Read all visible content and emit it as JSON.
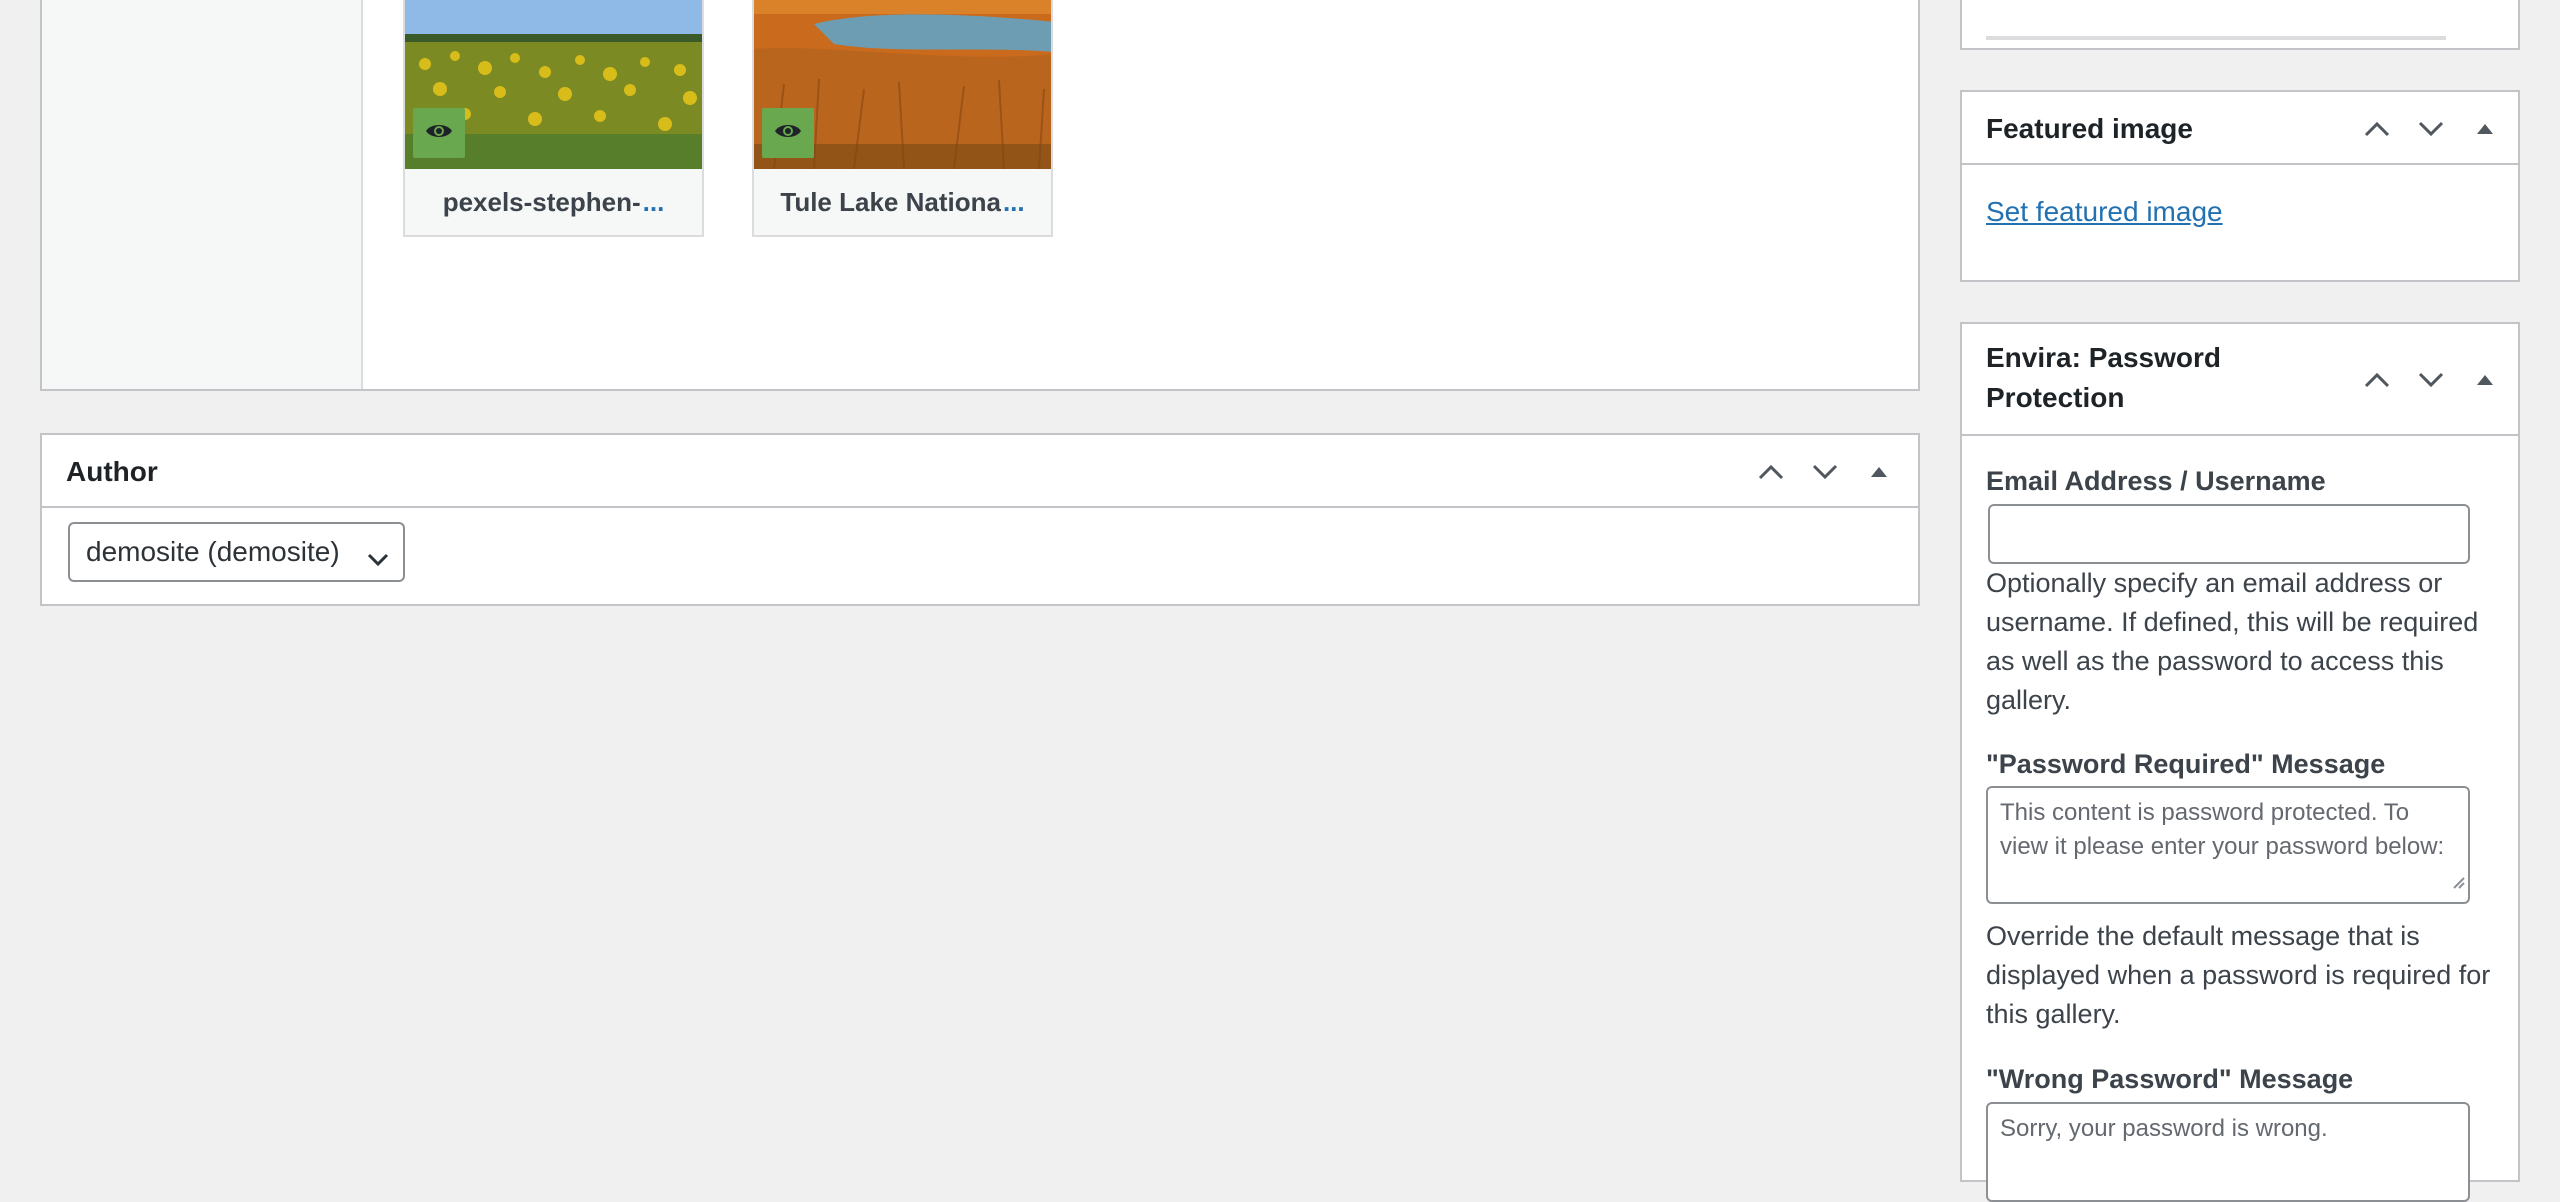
{
  "gallery": {
    "images": [
      {
        "title": "pexels-stephen-",
        "ellipsis": "...",
        "preview_icon": "eye-icon"
      },
      {
        "title": "Tule Lake Nationa",
        "ellipsis": "...",
        "preview_icon": "eye-icon"
      }
    ]
  },
  "author_box": {
    "title": "Author",
    "selected": "demosite (demosite)"
  },
  "featured_image": {
    "title": "Featured image",
    "link": "Set featured image"
  },
  "envira_password": {
    "title": "Envira: Password Protection",
    "email_label": "Email Address / Username",
    "email_value": "",
    "email_desc": "Optionally specify an email address or username. If defined, this will be required as well as the password to access this gallery.",
    "required_label": "\"Password Required\" Message",
    "required_placeholder": "This content is password protected. To view it please enter your password below:",
    "required_desc": "Override the default message that is displayed when a password is required for this gallery.",
    "wrong_label": "\"Wrong Password\" Message",
    "wrong_placeholder": "Sorry, your password is wrong."
  },
  "colors": {
    "accent_link": "#2271b1",
    "preview_button": "#6aa84f",
    "border": "#c3c4c7",
    "background": "#f0f0f1"
  }
}
